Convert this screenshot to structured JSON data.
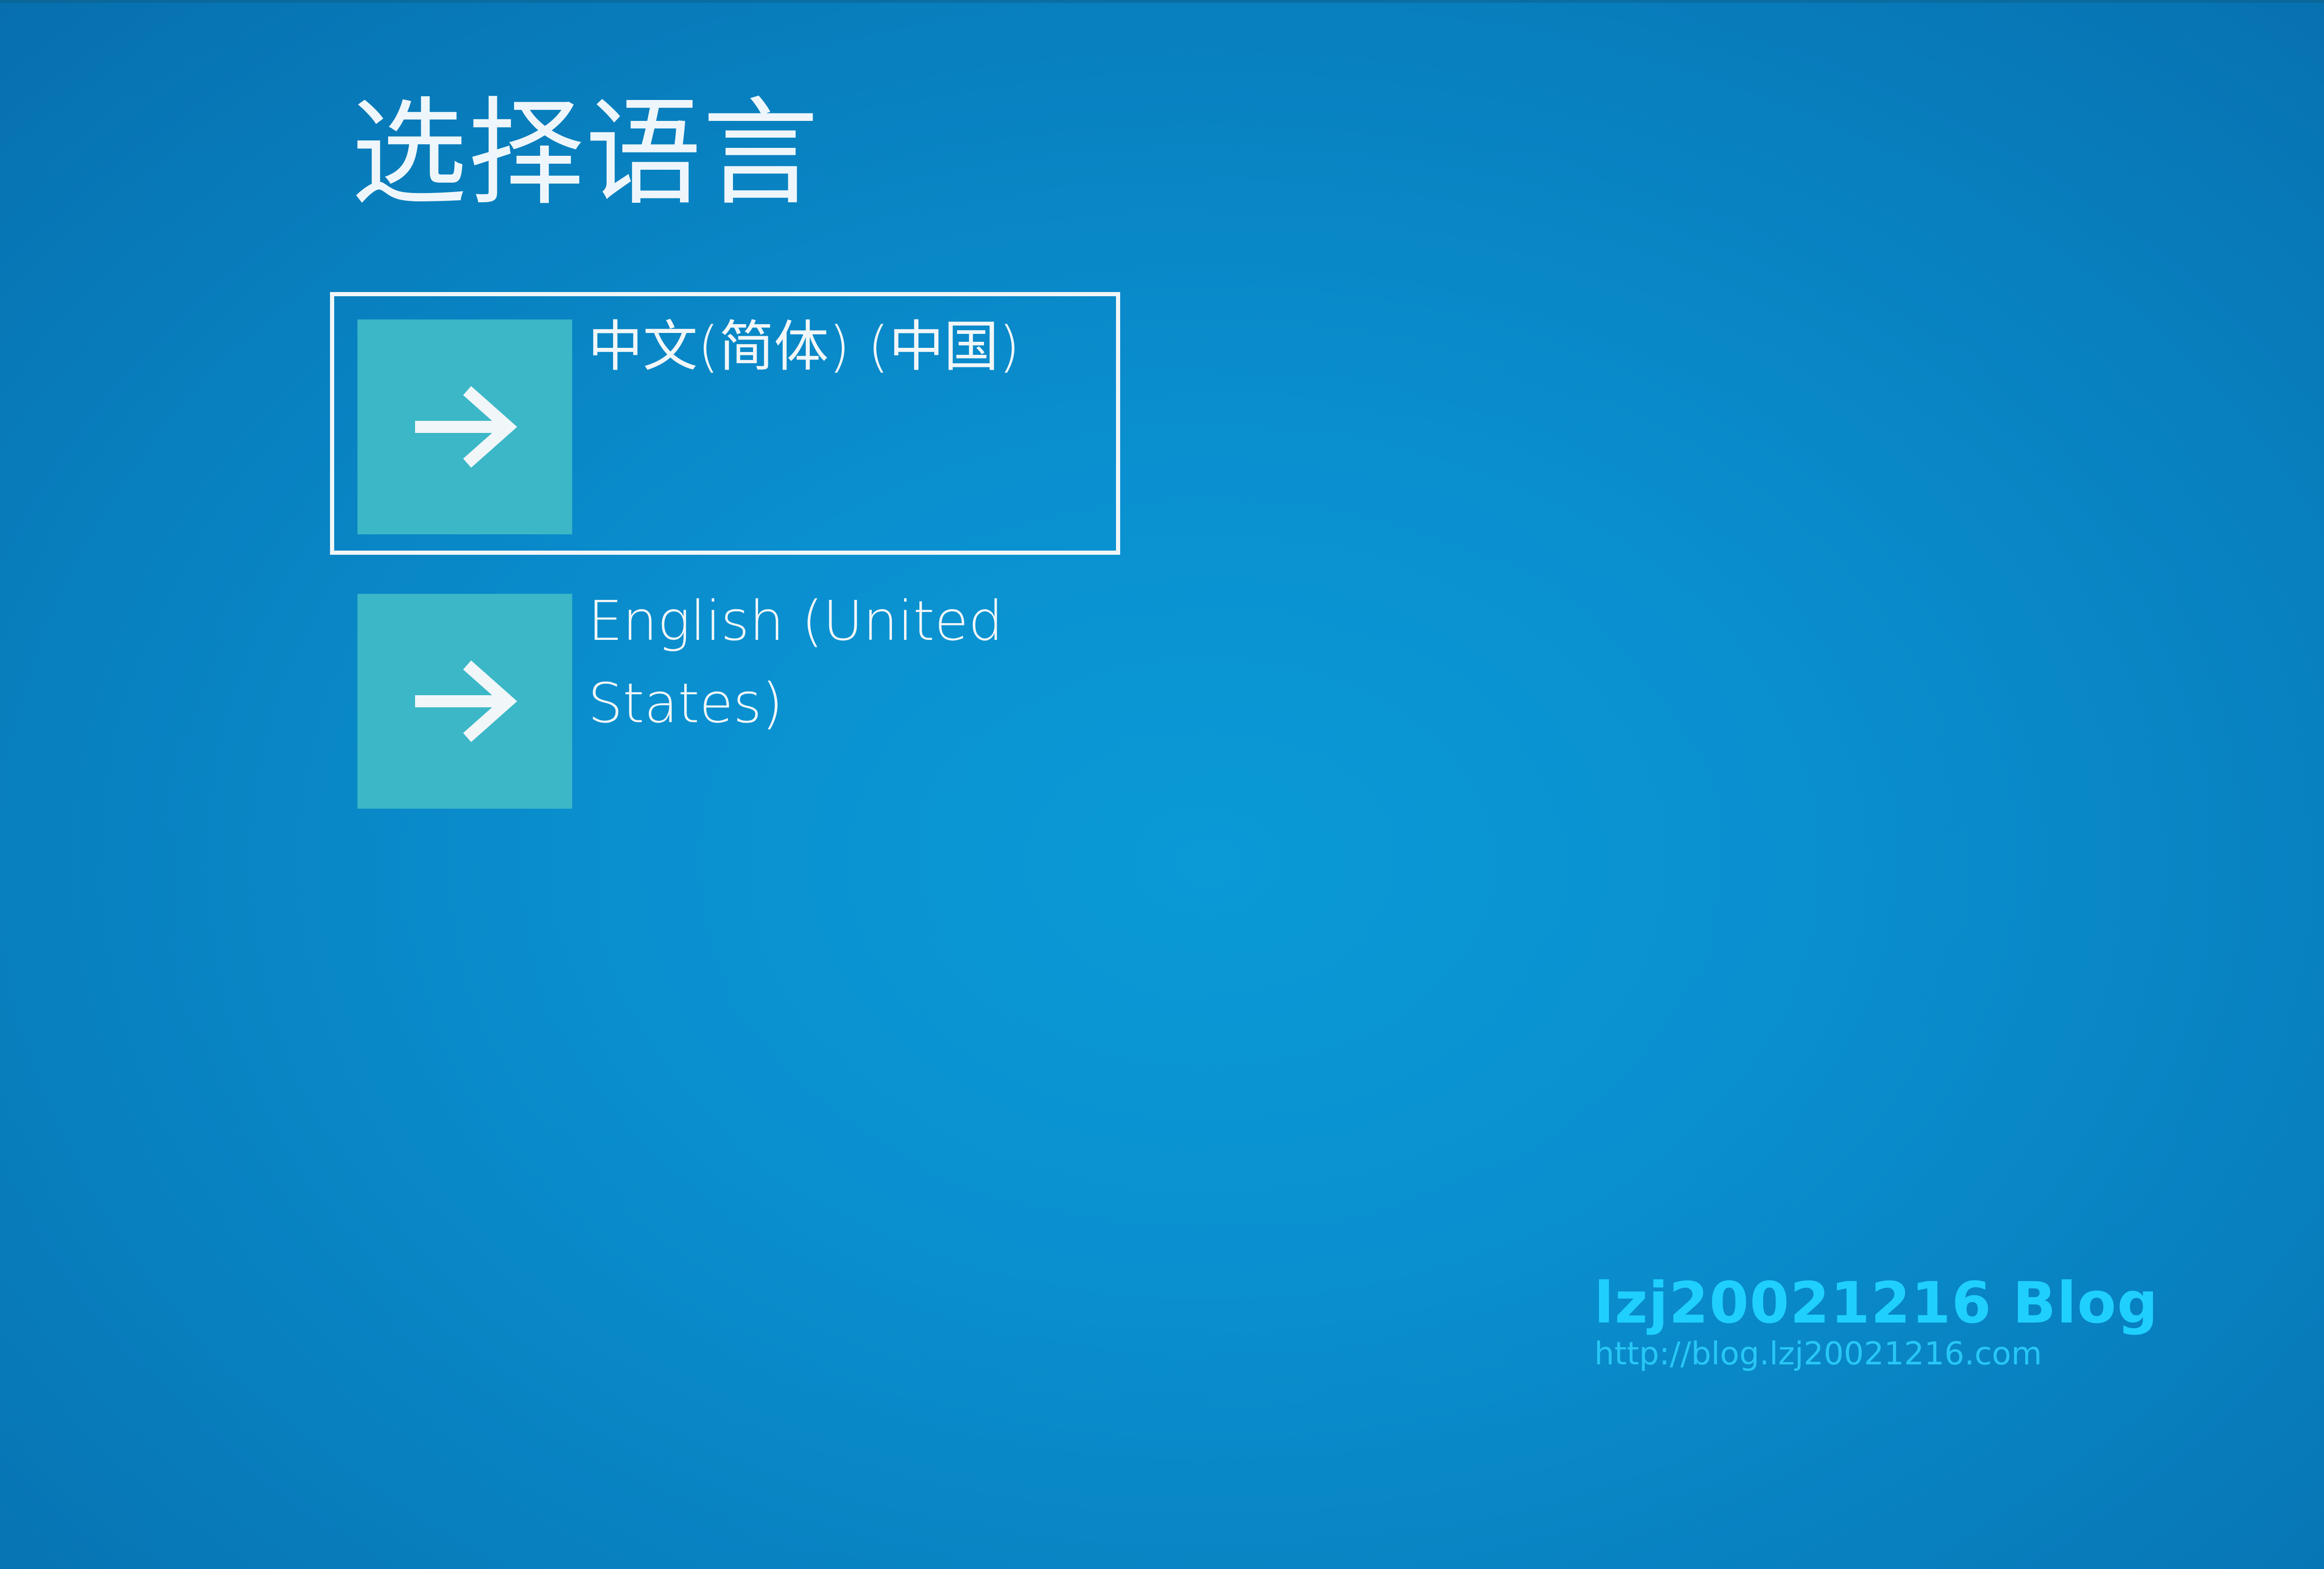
{
  "header": {
    "title": "选择语言"
  },
  "languages": [
    {
      "label": "中文(简体) (中国)",
      "selected": true
    },
    {
      "label": "English (United States)",
      "selected": false
    }
  ],
  "watermark": {
    "title": "lzj20021216 Blog",
    "url": "http://blog.lzj20021216.com"
  },
  "icons": {
    "language_tile": "arrow-right-icon"
  },
  "colors": {
    "background": "#0a8fcf",
    "tile": "#3bb7c7",
    "text": "#f1f6f8",
    "selection_border": "#f1f6f8",
    "watermark": "#1fd0ff"
  }
}
